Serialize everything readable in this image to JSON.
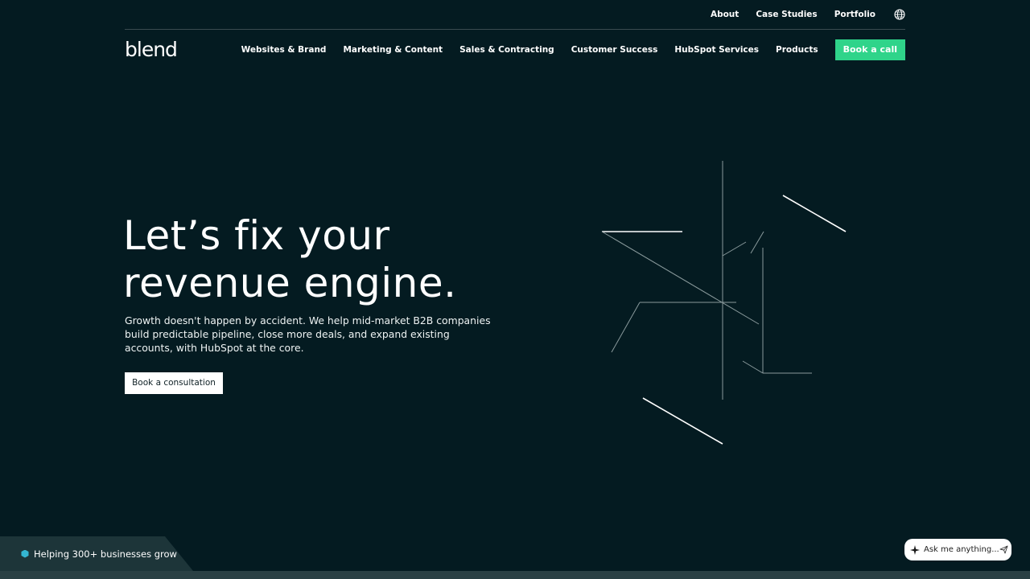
{
  "utility_nav": {
    "items": [
      "About",
      "Case Studies",
      "Portfolio"
    ],
    "language_icon": "globe-icon"
  },
  "brand": {
    "logo_text": "blend"
  },
  "main_nav": {
    "items": [
      "Websites & Brand",
      "Marketing & Content",
      "Sales & Contracting",
      "Customer Success",
      "HubSpot Services",
      "Products"
    ],
    "cta_label": "Book a call"
  },
  "hero": {
    "title_line1": "Let’s fix your",
    "title_line2": "revenue engine.",
    "subtitle": "Growth doesn't happen by accident. We help mid-market B2B companies build predictable pipeline, close more deals, and expand existing accounts, with HubSpot at the core.",
    "button_label": "Book a consultation"
  },
  "badge": {
    "text": "Helping 300+ businesses grow",
    "icon": "hexagon-icon"
  },
  "chat": {
    "placeholder": "Ask me anything...",
    "icon": "sparkle-icon",
    "send_icon": "send-icon"
  },
  "colors": {
    "background": "#041b21",
    "accent": "#2fd48a",
    "badge_bg": "#1d3539",
    "hex_icon": "#34b6d2"
  }
}
